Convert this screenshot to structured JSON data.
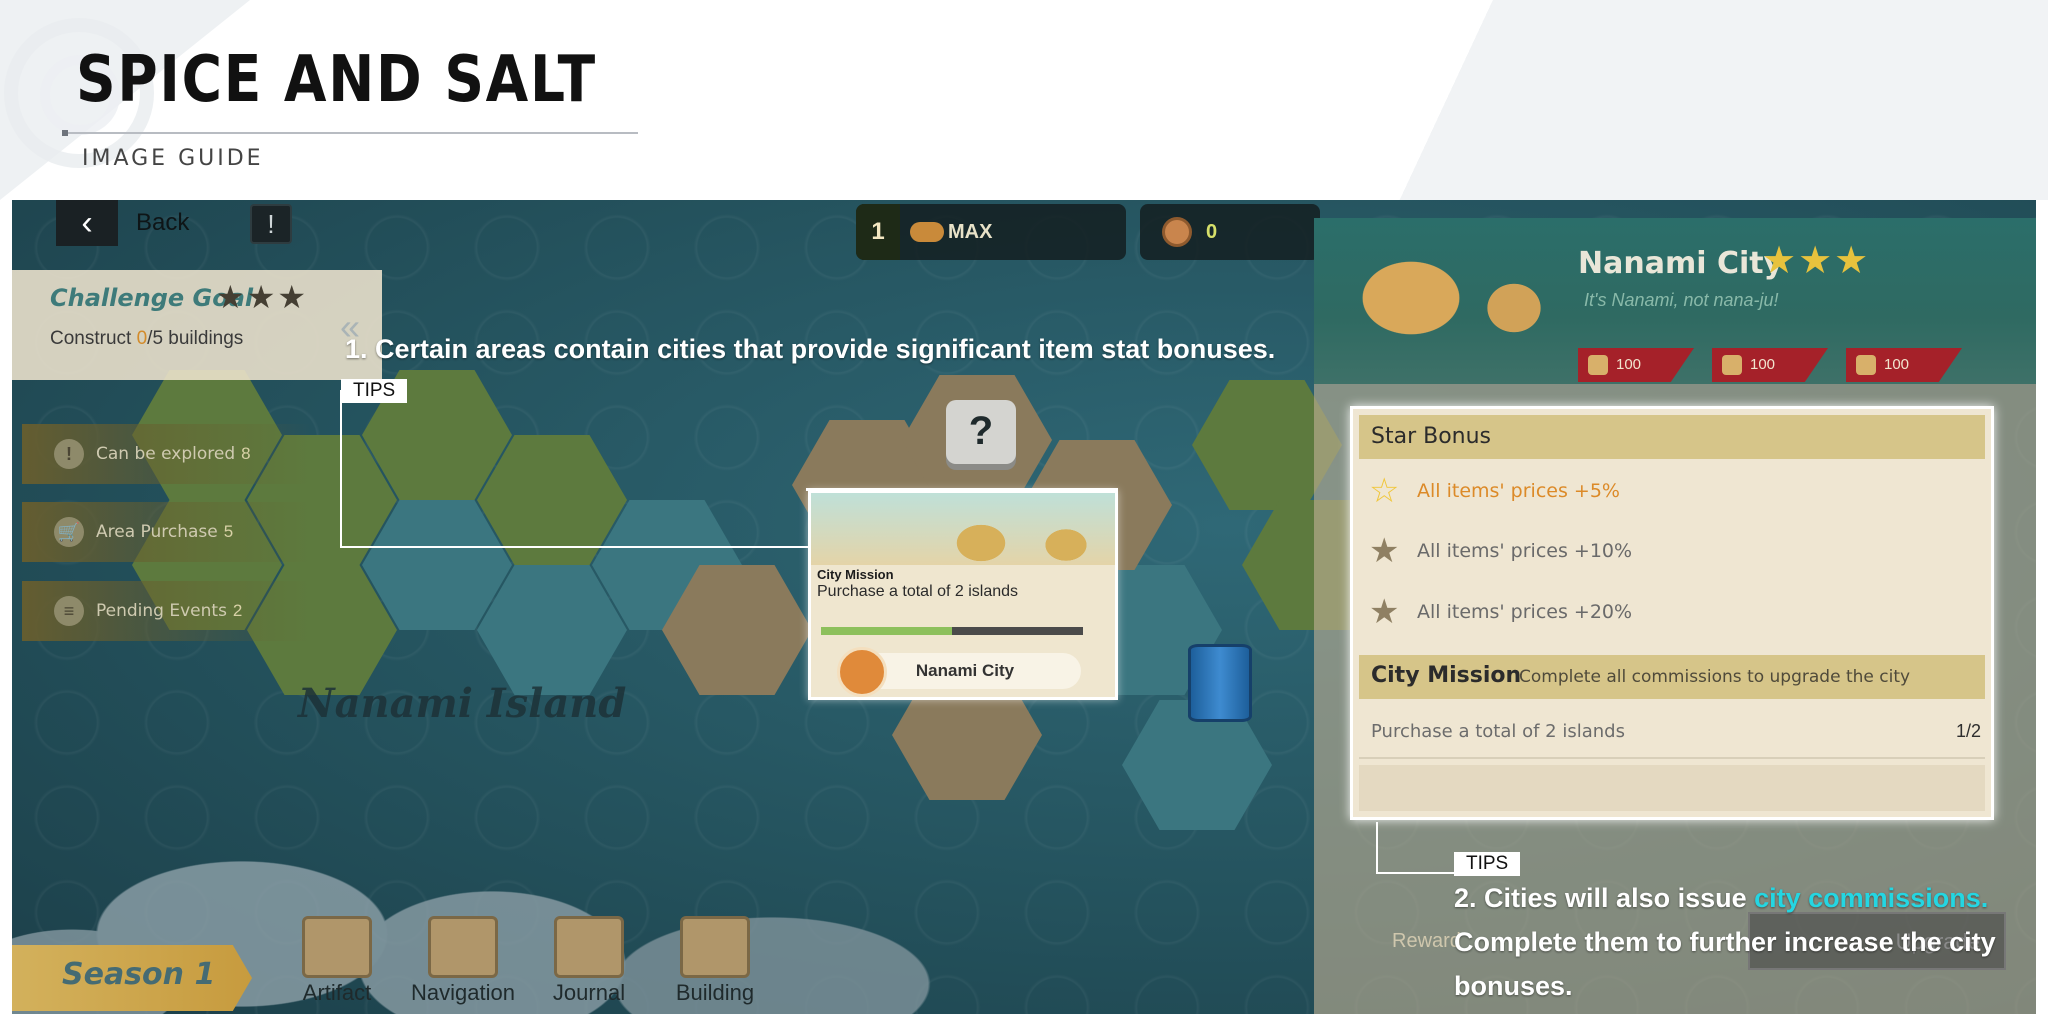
{
  "header": {
    "title": "SPICE AND SALT",
    "subtitle": "IMAGE GUIDE"
  },
  "top_bar": {
    "back_label": "Back",
    "info_icon": "info-icon",
    "level": "1",
    "level_label": "MAX",
    "coins": "0"
  },
  "challenge": {
    "title": "Challenge Goal",
    "stars": "★★★",
    "desc_prefix": "Construct ",
    "built": "0",
    "desc_suffix": "/5 buildings"
  },
  "side_menu": [
    {
      "icon": "!",
      "label": "Can be explored",
      "count": "8"
    },
    {
      "icon": "🛒",
      "label": "Area Purchase",
      "count": "5"
    },
    {
      "icon": "≡",
      "label": "Pending Events",
      "count": "2"
    }
  ],
  "map": {
    "island_name": "Nanami Island"
  },
  "mission_card": {
    "title": "City Mission",
    "desc": "Purchase a total of 2 islands",
    "progress": 0.5,
    "city": "Nanami City"
  },
  "bottom_bar": {
    "season": "Season 1",
    "buttons": [
      "Artifact",
      "Navigation",
      "Journal",
      "Building"
    ]
  },
  "city_panel": {
    "name": "Nanami City",
    "stars": "★★★",
    "tagline": "It's Nanami, not nana-ju!",
    "resources": [
      "100",
      "100",
      "100"
    ],
    "star_bonus_title": "Star Bonus",
    "star_bonuses": [
      {
        "text": "All items' prices +5%",
        "active": true
      },
      {
        "text": "All items' prices +10%",
        "active": false
      },
      {
        "text": "All items' prices +20%",
        "active": false
      }
    ],
    "city_mission_title": "City Mission",
    "city_mission_sub": "Complete all commissions to upgrade the city",
    "commission": {
      "text": "Purchase a total of 2 islands",
      "progress": "1/2"
    },
    "reward_label": "Reward",
    "upgrade_label": "Upgrade"
  },
  "annotations": {
    "tip1_badge": "TIPS",
    "tip1_text": "1. Certain areas contain cities that provide significant item stat bonuses.",
    "tip2_badge": "TIPS",
    "tip2_prefix": "2. Cities will also issue ",
    "tip2_highlight": "city commissions.",
    "tip2_suffix": "Complete them to further increase the city bonuses."
  },
  "colors": {
    "highlight": "#24d6e2",
    "active_bonus": "#dc8a28",
    "star_gold": "#f0c63a"
  }
}
